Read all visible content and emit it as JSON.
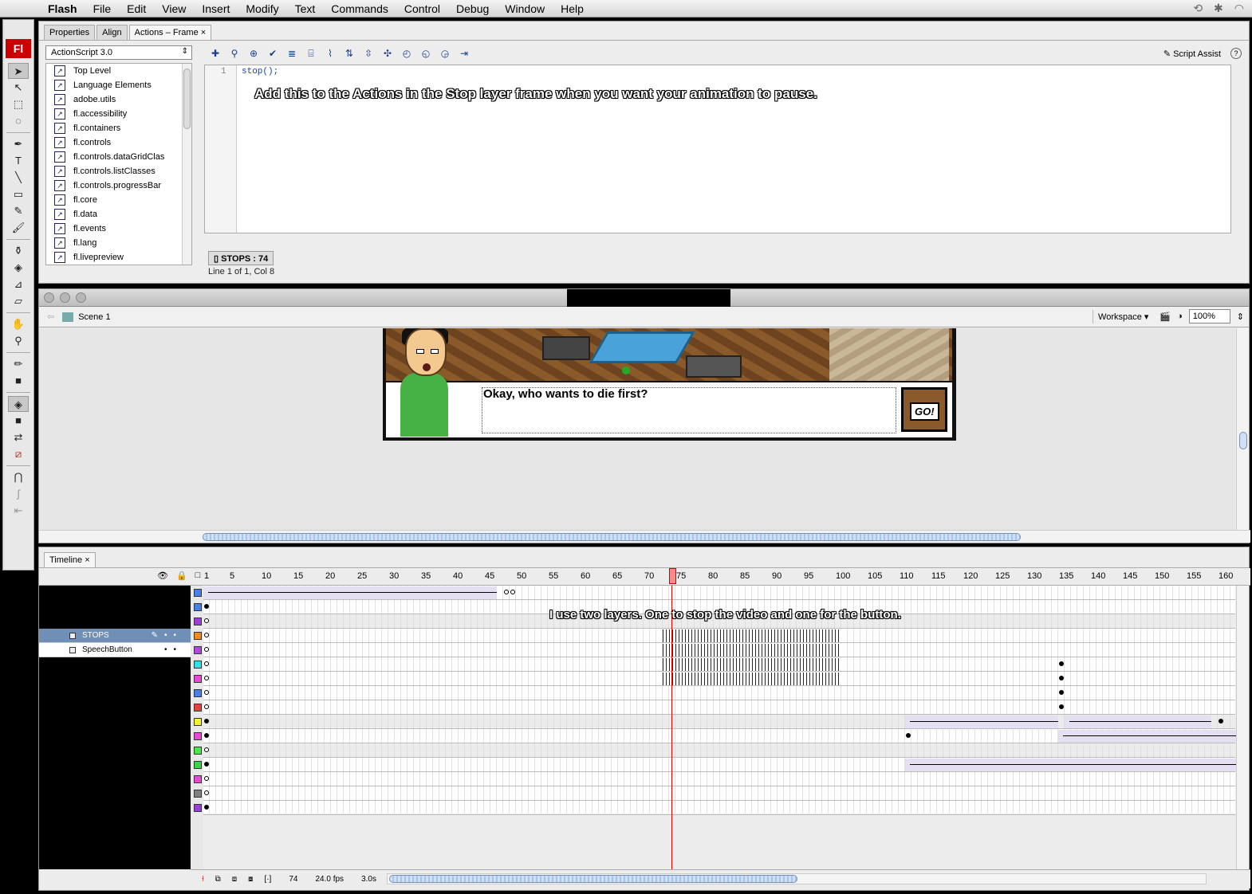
{
  "menubar": {
    "app": "Flash",
    "items": [
      "File",
      "Edit",
      "View",
      "Insert",
      "Modify",
      "Text",
      "Commands",
      "Control",
      "Debug",
      "Window",
      "Help"
    ]
  },
  "actions_panel": {
    "tabs": [
      "Properties",
      "Align",
      "Actions – Frame"
    ],
    "language": "ActionScript 3.0",
    "tree": [
      "Top Level",
      "Language Elements",
      "adobe.utils",
      "fl.accessibility",
      "fl.containers",
      "fl.controls",
      "fl.controls.dataGridClas",
      "fl.controls.listClasses",
      "fl.controls.progressBar",
      "fl.core",
      "fl.data",
      "fl.events",
      "fl.lang",
      "fl.livepreview"
    ],
    "script_assist": "Script Assist",
    "line_number": "1",
    "code": "stop();",
    "caption": "Add this to the Actions in the Stop layer frame when you want your animation to pause.",
    "frame_tab": "STOPS : 74",
    "status": "Line 1 of 1, Col 8"
  },
  "stage": {
    "scene": "Scene 1",
    "workspace": "Workspace",
    "zoom": "100%",
    "speech_text": "Okay, who wants to die first?",
    "go_label": "GO!"
  },
  "timeline": {
    "tab": "Timeline",
    "ruler": [
      "1",
      "5",
      "10",
      "15",
      "20",
      "25",
      "30",
      "35",
      "40",
      "45",
      "50",
      "55",
      "60",
      "65",
      "70",
      "75",
      "80",
      "85",
      "90",
      "95",
      "100",
      "105",
      "110",
      "115",
      "120",
      "125",
      "130",
      "135",
      "140",
      "145",
      "150",
      "155",
      "160"
    ],
    "layers": [
      {
        "name": "STOPS",
        "selected": true
      },
      {
        "name": "SpeechButton",
        "selected": false
      }
    ],
    "caption": "I use two layers. One to stop the video and one for the button.",
    "current_frame": "74",
    "fps": "24.0 fps",
    "time": "3.0s",
    "layer_colors": [
      "#4a7ee8",
      "#4a7ee8",
      "#9b3fd6",
      "#f28a1e",
      "#b04ad6",
      "#35e0e8",
      "#e84ad6",
      "#4a7ee8",
      "#e84040",
      "#f5f03a",
      "#e84ad6",
      "#4ae84a",
      "#3ad64a",
      "#e84ad6",
      "#808080",
      "#9b3fd6"
    ]
  }
}
